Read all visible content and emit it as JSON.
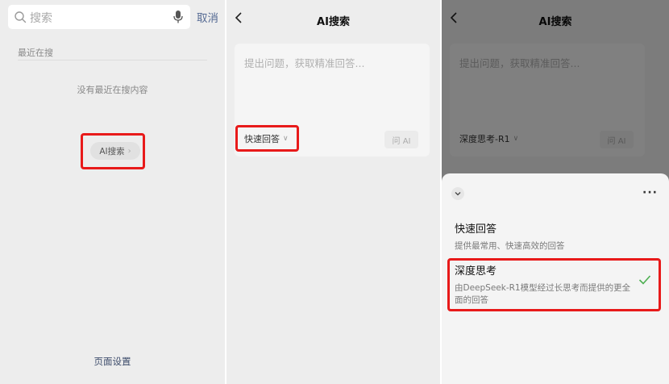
{
  "panel1": {
    "search_placeholder": "搜索",
    "cancel_label": "取消",
    "recent_label": "最近在搜",
    "empty_text": "没有最近在搜内容",
    "ai_button_label": "AI搜索",
    "ai_button_chevron": "›",
    "page_settings_label": "页面设置"
  },
  "panel2": {
    "title": "AI搜索",
    "placeholder": "提出问题，获取精准回答...",
    "mode_label": "快速回答",
    "mode_chevron": "∨",
    "ask_label": "问 AI"
  },
  "panel3": {
    "title": "AI搜索",
    "placeholder": "提出问题，获取精准回答...",
    "mode_label": "深度思考-R1",
    "mode_chevron": "∨",
    "ask_label": "问 AI",
    "sheet": {
      "more_label": "···",
      "options": [
        {
          "title": "快速回答",
          "desc": "提供最常用、快速高效的回答"
        },
        {
          "title": "深度思考",
          "desc": "由DeepSeek-R1模型经过长思考而提供的更全面的回答",
          "selected": true
        }
      ]
    }
  },
  "colors": {
    "highlight": "#e81a1a",
    "link": "#566b94",
    "check": "#4caf50"
  }
}
